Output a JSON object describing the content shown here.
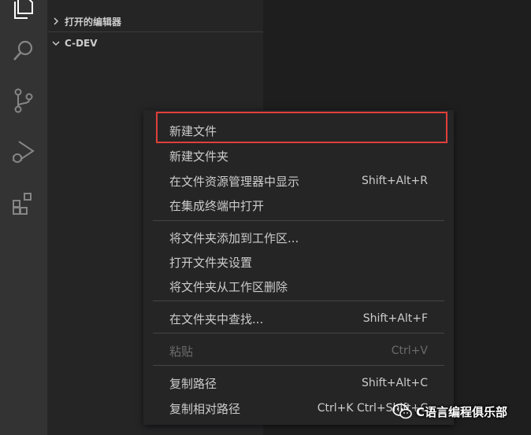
{
  "sidebar": {
    "open_editors_label": "打开的编辑器",
    "workspace_label": "C-DEV"
  },
  "activity_icons": [
    "explorer-icon",
    "search-icon",
    "source-control-icon",
    "run-debug-icon",
    "extensions-icon"
  ],
  "context_menu": {
    "items": [
      {
        "label": "新建文件",
        "shortcut": ""
      },
      {
        "label": "新建文件夹",
        "shortcut": ""
      },
      {
        "label": "在文件资源管理器中显示",
        "shortcut": "Shift+Alt+R"
      },
      {
        "label": "在集成终端中打开",
        "shortcut": ""
      },
      {
        "label": "将文件夹添加到工作区...",
        "shortcut": ""
      },
      {
        "label": "打开文件夹设置",
        "shortcut": ""
      },
      {
        "label": "将文件夹从工作区删除",
        "shortcut": ""
      },
      {
        "label": "在文件夹中查找...",
        "shortcut": "Shift+Alt+F"
      },
      {
        "label": "粘贴",
        "shortcut": "Ctrl+V"
      },
      {
        "label": "复制路径",
        "shortcut": "Shift+Alt+C"
      },
      {
        "label": "复制相对路径",
        "shortcut": "Ctrl+K Ctrl+Shift+C"
      }
    ]
  },
  "watermark": {
    "text": "C语言编程俱乐部"
  },
  "colors": {
    "highlight_border": "#e0403a",
    "menu_bg": "#252526",
    "activity_bar_bg": "#333333"
  }
}
